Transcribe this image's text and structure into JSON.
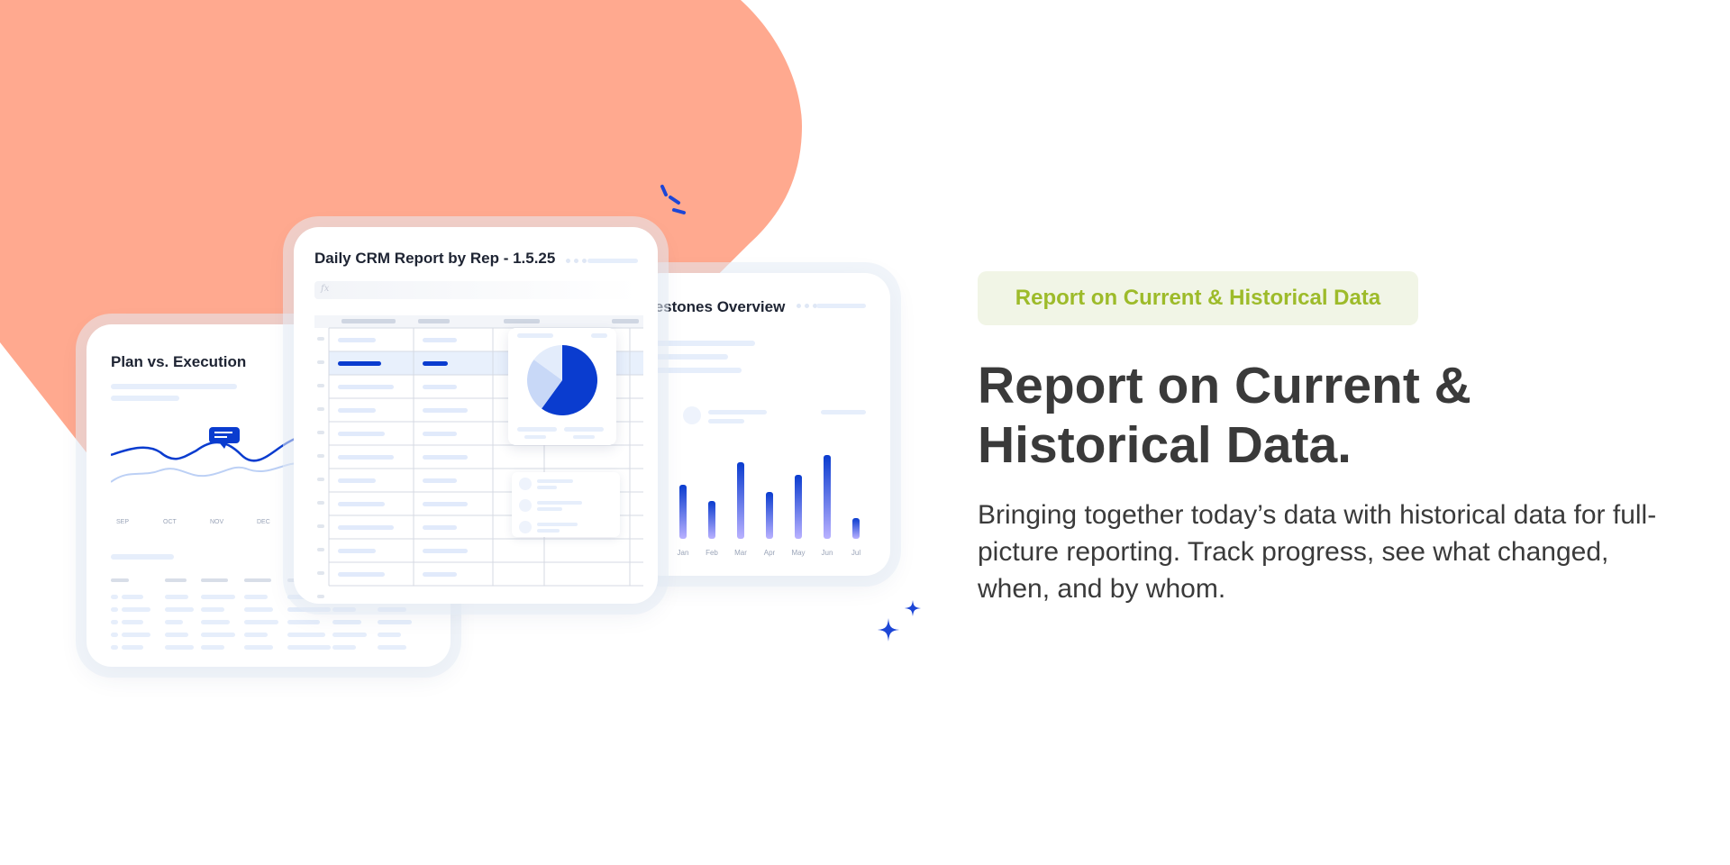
{
  "colors": {
    "blob": "#ffa98f",
    "accent": "#0a3ccf",
    "tag_bg": "#f1f5e6",
    "tag_text": "#9dbb2a",
    "text": "#3a3a3a"
  },
  "cards": {
    "plan": {
      "title": "Plan vs. Execution",
      "months": [
        "SEP",
        "OCT",
        "NOV",
        "DEC"
      ]
    },
    "daily": {
      "title": "Daily CRM Report by Rep - 1.5.25",
      "formula_icon": "fx"
    },
    "milestones": {
      "title": "lestones Overview",
      "months": [
        "Jan",
        "Feb",
        "Mar",
        "Apr",
        "May",
        "Jun",
        "Jul"
      ]
    }
  },
  "chart_data": {
    "type": "bar",
    "categories": [
      "Jan",
      "Feb",
      "Mar",
      "Apr",
      "May",
      "Jun",
      "Jul"
    ],
    "values": [
      60,
      42,
      85,
      52,
      71,
      93,
      23
    ],
    "ylim": [
      0,
      100
    ]
  },
  "pie_data": {
    "type": "pie",
    "values": [
      60,
      25,
      15
    ]
  },
  "tag": {
    "label": "Report on Current & Historical Data"
  },
  "headline": {
    "line1": "Report on Current &",
    "line2": "Historical Data."
  },
  "description": "Bringing together today’s data with historical data for full-picture reporting. Track progress, see what changed, when, and by whom.",
  "decor": {
    "sparkle_icon": "sparkle-icon",
    "burst_icon": "burst-icon",
    "comment_icon": "comment-icon"
  }
}
